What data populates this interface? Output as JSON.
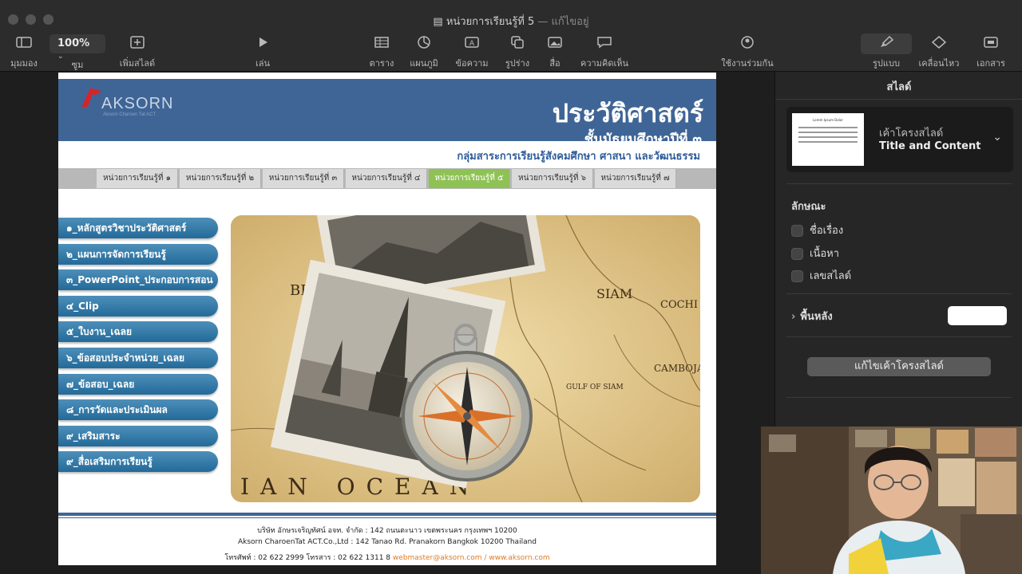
{
  "window": {
    "title": "หน่วยการเรียนรู้ที่ 5",
    "status": "— แก้ไขอยู่"
  },
  "toolbar": {
    "view_label": "มุมมอง",
    "zoom_value": "100%",
    "zoom_label": "ซูม",
    "add_slide_label": "เพิ่มสไลด์",
    "play_label": "เล่น",
    "table_label": "ตาราง",
    "chart_label": "แผนภูมิ",
    "text_label": "ข้อความ",
    "shape_label": "รูปร่าง",
    "media_label": "สื่อ",
    "comment_label": "ความคิดเห็น",
    "collaborate_label": "ใช้งานร่วมกัน",
    "format_label": "รูปแบบ",
    "animate_label": "เคลื่อนไหว",
    "document_label": "เอกสาร"
  },
  "slide": {
    "logo_text": "AKSORN",
    "logo_sub": "Aksorn Charoen Tat ACT",
    "title": "ประวัติศาสตร์",
    "subtitle": "ชั้นมัธยมศึกษาปีที่  ๓",
    "department": "กลุ่มสาระการเรียนรู้สังคมศึกษา ศาสนา และวัฒนธรรม",
    "tabs": [
      {
        "label": "หน่วยการเรียนรู้ที่ ๑"
      },
      {
        "label": "หน่วยการเรียนรู้ที่ ๒"
      },
      {
        "label": "หน่วยการเรียนรู้ที่ ๓"
      },
      {
        "label": "หน่วยการเรียนรู้ที่ ๔"
      },
      {
        "label": "หน่วยการเรียนรู้ที่ ๕"
      },
      {
        "label": "หน่วยการเรียนรู้ที่ ๖"
      },
      {
        "label": "หน่วยการเรียนรู้ที่ ๗"
      }
    ],
    "active_tab": 4,
    "menu": [
      {
        "label": "๑_หลักสูตรวิชาประวัติศาสตร์"
      },
      {
        "label": "๒_แผนการจัดการเรียนรู้"
      },
      {
        "label": "๓_PowerPoint_ประกอบการสอน"
      },
      {
        "label": "๔_Clip"
      },
      {
        "label": "๕_ใบงาน_เฉลย"
      },
      {
        "label": "๖_ข้อสอบประจำหน่วย_เฉลย"
      },
      {
        "label": "๗_ข้อสอบ_เฉลย"
      },
      {
        "label": "๘_การวัดและประเมินผล"
      },
      {
        "label": "๙_เสริมสาระ"
      },
      {
        "label": "๙_สื่อเสริมการเรียนรู้"
      }
    ],
    "map_labels": {
      "siam": "SIAM",
      "gulf": "GULF OF SIAM",
      "ocean": "IAN OCEAN",
      "be": "BE",
      "cochi": "COCHI",
      "camboja": "CAMBOJA"
    },
    "footer": {
      "line1": "บริษัท อักษรเจริญทัศน์ อจท. จำกัด : 142 ถนนตะนาว เขตพระนคร กรุงเทพฯ 10200",
      "line2": "Aksorn CharoenTat ACT.Co.,Ltd : 142 Tanao Rd. Pranakorn Bangkok 10200 Thailand",
      "line3_phone": "โทรศัพท์ : 02 622 2999  โทรสาร : 02 622 1311 8",
      "line3_links": "webmaster@aksorn.com / www.aksorn.com"
    }
  },
  "sidebar": {
    "title": "สไลด์",
    "layout_label": "เค้าโครงสไลด์",
    "layout_name": "Title and Content",
    "thumb_title": "Lorem Ipsum Dolor",
    "appearance_title": "ลักษณะ",
    "checks": [
      {
        "label": "ชื่อเรื่อง"
      },
      {
        "label": "เนื้อหา"
      },
      {
        "label": "เลขสไลด์"
      }
    ],
    "background_label": "พื้นหลัง",
    "edit_layout_button": "แก้ไขเค้าโครงสไลด์"
  },
  "colors": {
    "banner": "#3f6596",
    "active_tab": "#8fc255",
    "menu_button": "#2f77a6"
  }
}
